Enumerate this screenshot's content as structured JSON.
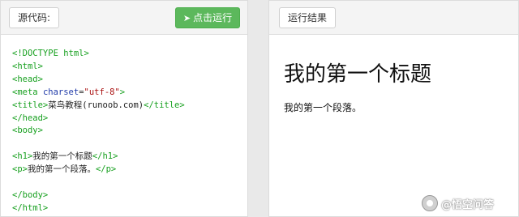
{
  "left_panel": {
    "source_button_label": "源代码:",
    "run_button_label": "点击运行",
    "run_icon": "paper-plane-icon",
    "code_lines": {
      "l1": "<!DOCTYPE html>",
      "l2": "<html>",
      "l3": "<head>",
      "l4_tag_open": "<meta ",
      "l4_attr": "charset",
      "l4_eq": "=",
      "l4_str": "\"utf-8\"",
      "l4_close": ">",
      "l5_open": "<title>",
      "l5_text": "菜鸟教程(runoob.com)",
      "l5_close": "</title>",
      "l6": "</head>",
      "l7": "<body>",
      "l9_open": "<h1>",
      "l9_text": "我的第一个标题",
      "l9_close": "</h1>",
      "l10_open": "<p>",
      "l10_text": "我的第一个段落。",
      "l10_close": "</p>",
      "l12": "</body>",
      "l13": "</html>"
    }
  },
  "right_panel": {
    "result_button_label": "运行结果",
    "heading": "我的第一个标题",
    "paragraph": "我的第一个段落。"
  },
  "watermark": {
    "text": "@悟空问答"
  },
  "colors": {
    "run_button": "#5cb85c",
    "code_tag": "#17a01f",
    "code_attr": "#1f3aa8",
    "code_string": "#aa1111"
  }
}
